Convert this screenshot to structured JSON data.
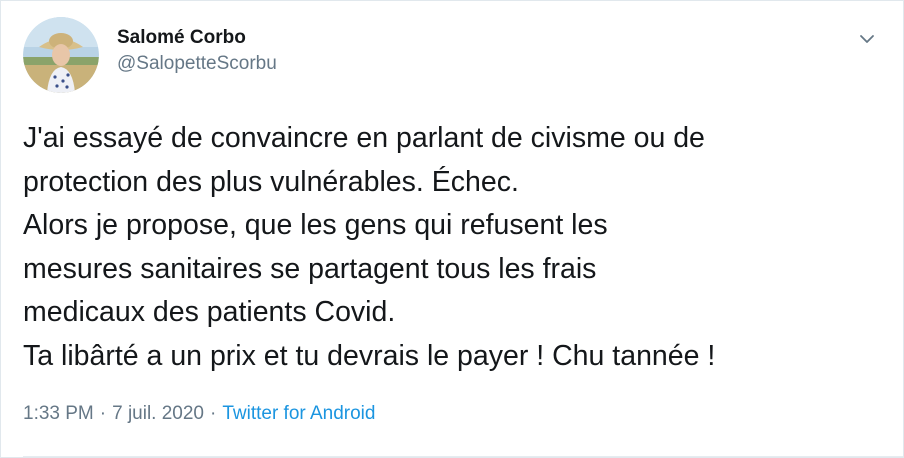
{
  "author": {
    "display_name": "Salomé Corbo",
    "handle": "@SalopetteScorbu",
    "avatar_icon": "profile-photo-avatar"
  },
  "menu": {
    "caret_icon": "chevron-down-icon"
  },
  "tweet": {
    "lines": [
      "J'ai essayé de convaincre en parlant de civisme ou de",
      "protection des plus vulnérables. Échec.",
      "Alors je propose, que les gens qui refusent les",
      "mesures sanitaires se partagent tous les frais",
      "medicaux des patients Covid.",
      "Ta libârté a un prix et tu devrais le payer ! Chu tannée !"
    ]
  },
  "meta": {
    "time": "1:33 PM",
    "separator": "·",
    "date": "7 juil. 2020",
    "source": "Twitter for Android"
  },
  "colors": {
    "text": "#14171a",
    "secondary": "#657786",
    "link": "#1b95e0",
    "border": "#e1e8ed"
  }
}
